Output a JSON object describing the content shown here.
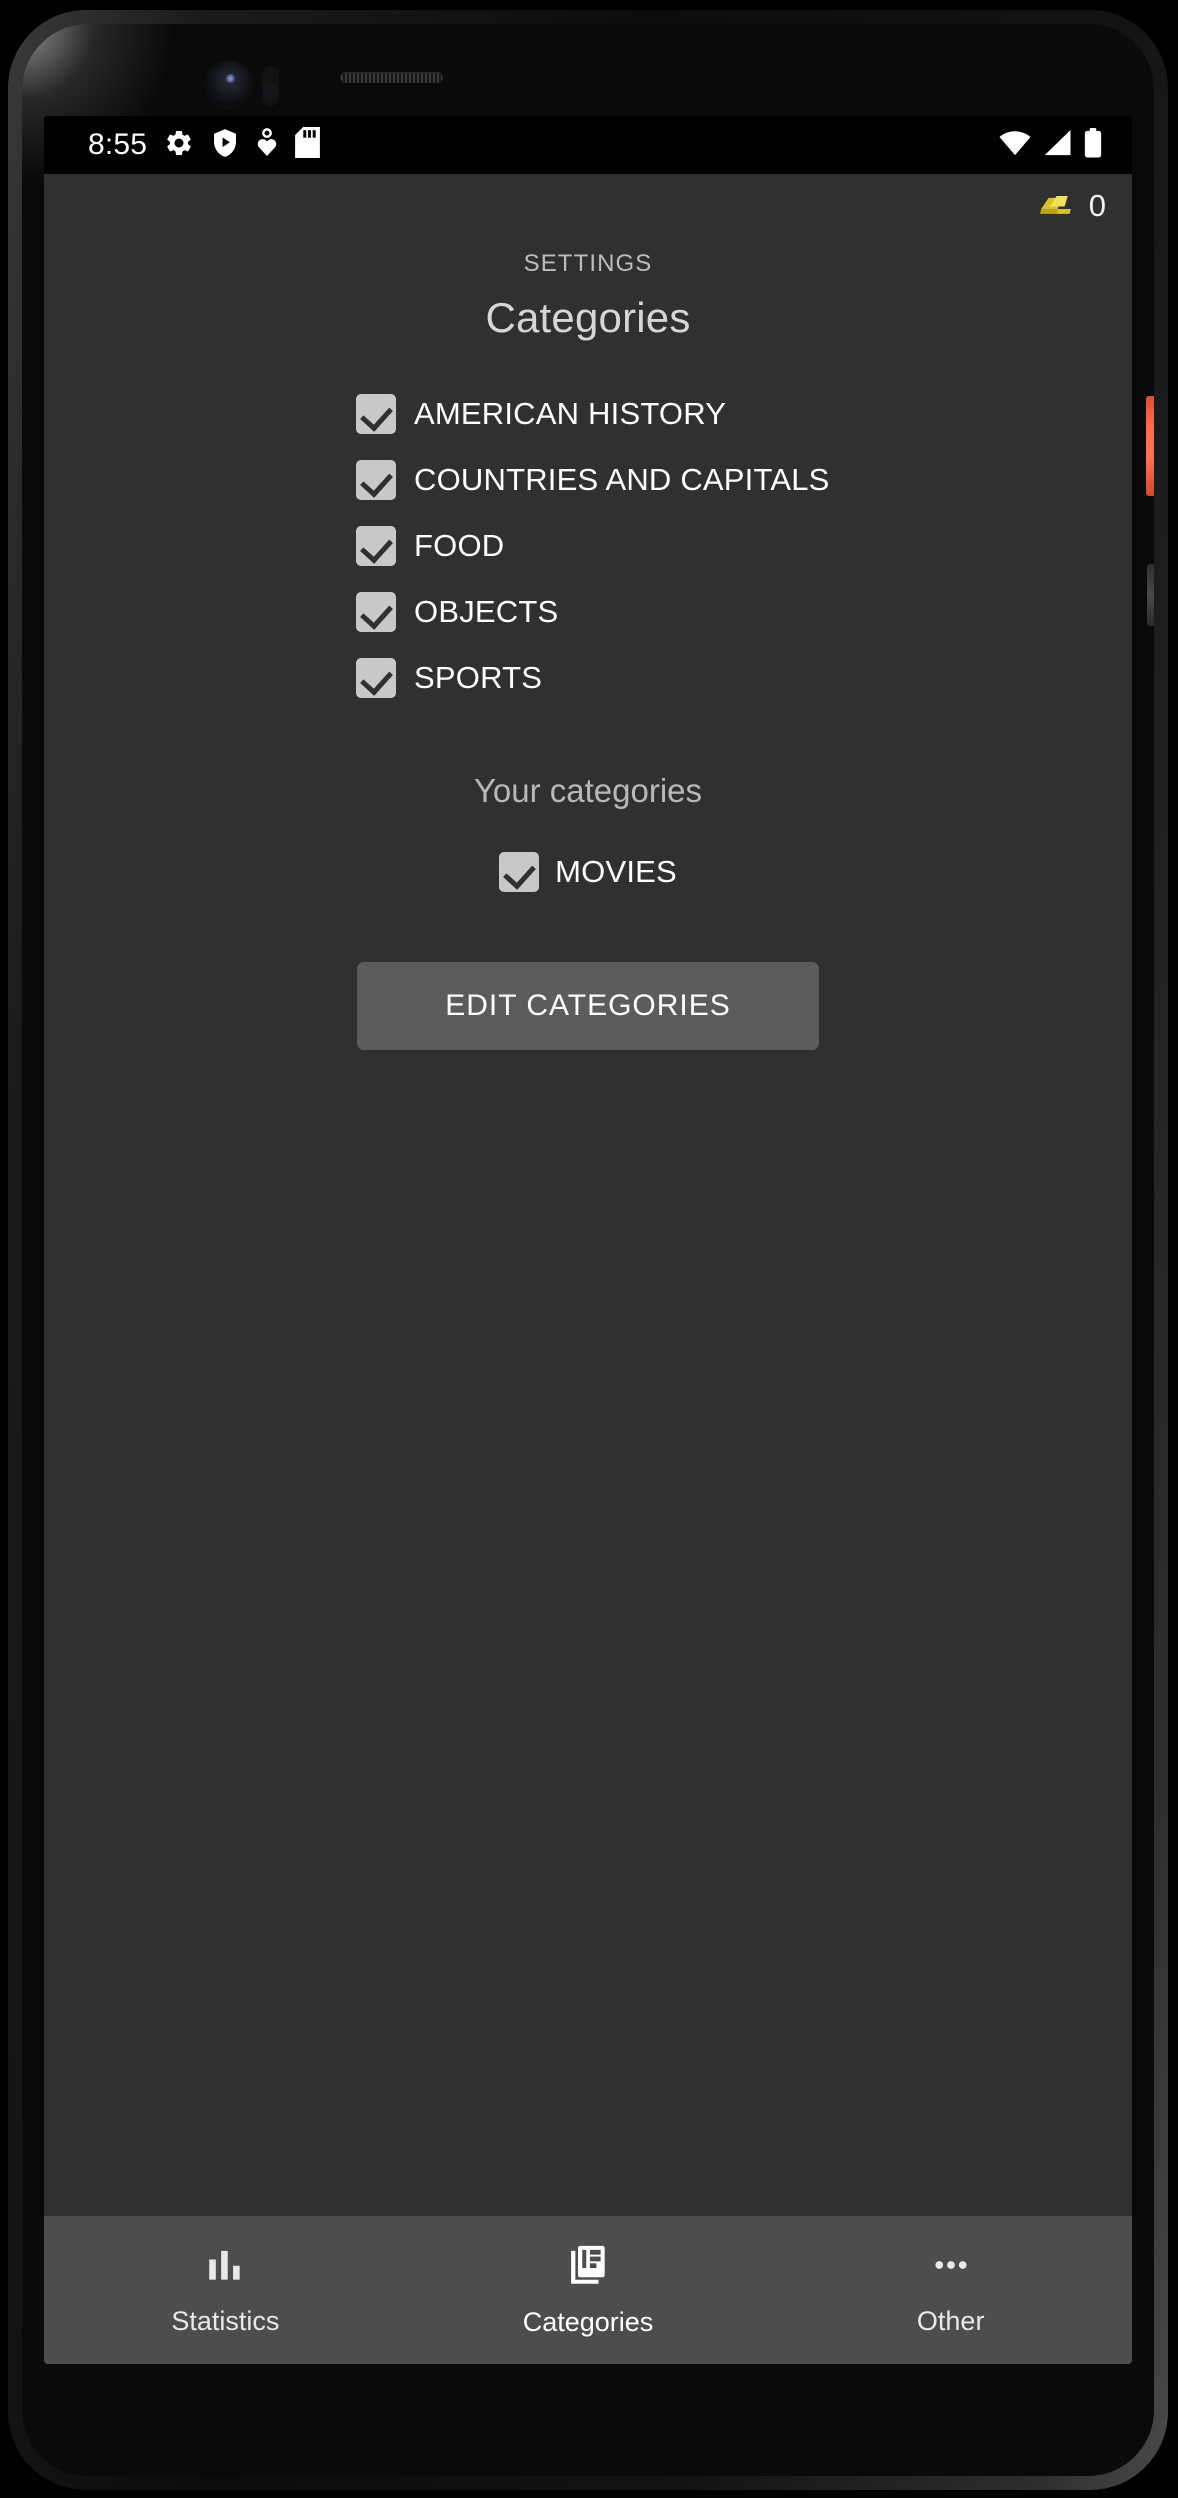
{
  "status_bar": {
    "time": "8:55",
    "left_icons": [
      "gear-icon",
      "shield-play-icon",
      "heart-location-icon",
      "sd-card-icon"
    ],
    "right_icons": [
      "wifi-icon",
      "cellular-signal-icon",
      "battery-icon"
    ]
  },
  "app": {
    "gold": {
      "icon": "gold-bar-icon",
      "count": "0"
    },
    "header": {
      "eyebrow": "SETTINGS",
      "title": "Categories"
    },
    "default_categories": [
      {
        "label": "AMERICAN HISTORY",
        "checked": true
      },
      {
        "label": "COUNTRIES AND CAPITALS",
        "checked": true
      },
      {
        "label": "FOOD",
        "checked": true
      },
      {
        "label": "OBJECTS",
        "checked": true
      },
      {
        "label": "SPORTS",
        "checked": true
      }
    ],
    "user_section": {
      "heading": "Your categories",
      "categories": [
        {
          "label": "MOVIES",
          "checked": true
        }
      ]
    },
    "edit_button_label": "EDIT CATEGORIES",
    "bottom_nav": [
      {
        "label": "Statistics",
        "icon": "bar-chart-icon",
        "active": false
      },
      {
        "label": "Categories",
        "icon": "cards-stack-icon",
        "active": true
      },
      {
        "label": "Other",
        "icon": "more-horizontal-icon",
        "active": false
      }
    ]
  },
  "colors": {
    "screen_background": "#303030",
    "nav_background": "#4d4d4d",
    "button_background": "#5c5c5c",
    "checkbox_fill": "#c8c8c8",
    "gold": "#d9c02a",
    "power_button": "#ff6a45"
  }
}
